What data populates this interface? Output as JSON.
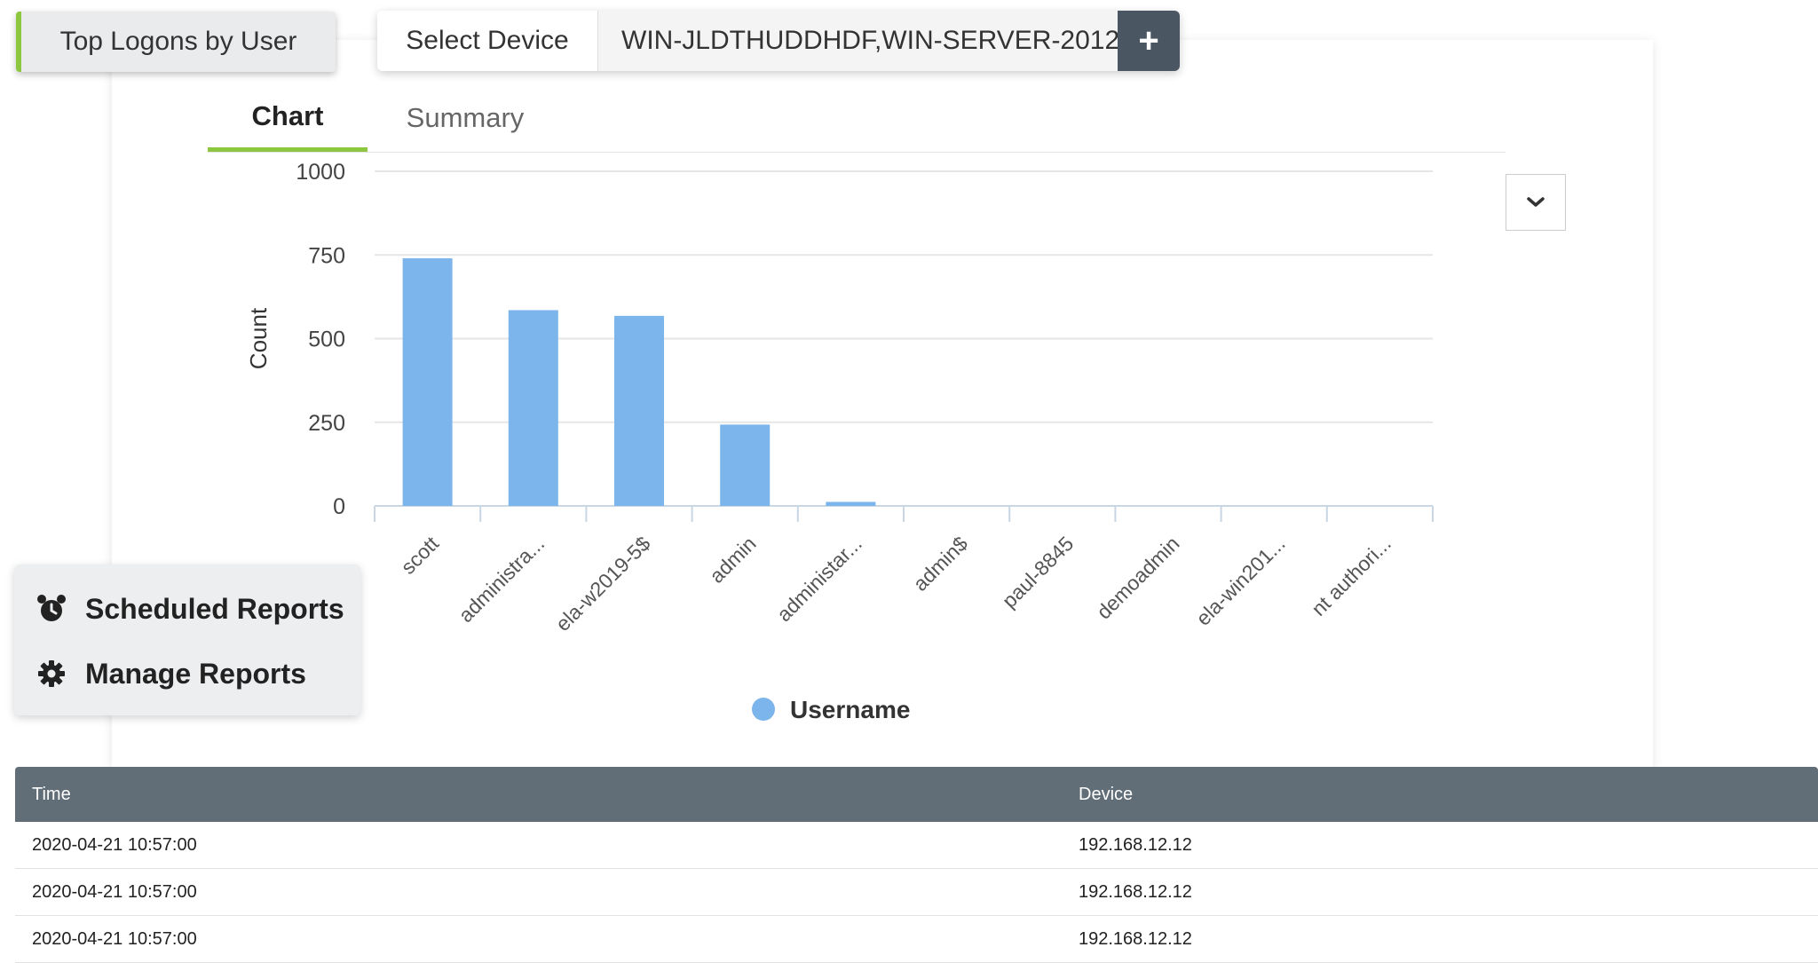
{
  "report": {
    "title": "Top Logons by User"
  },
  "device_selector": {
    "label": "Select Device",
    "value": "WIN-JLDTHUDDHDF,WIN-SERVER-2012",
    "add_icon": "plus-icon"
  },
  "tabs": [
    {
      "label": "Chart",
      "active": true
    },
    {
      "label": "Summary",
      "active": false
    }
  ],
  "options_icon": "chevron-down-icon",
  "chart_data": {
    "type": "bar",
    "ylabel": "Count",
    "ylim": [
      0,
      1000
    ],
    "yticks": [
      0,
      250,
      500,
      750,
      1000
    ],
    "categories": [
      "scott",
      "administra...",
      "ela-w2019-5$",
      "admin",
      "administar...",
      "admin$",
      "paul-8845",
      "demoadmin",
      "ela-win201...",
      "nt authori..."
    ],
    "series": [
      {
        "name": "Username",
        "color": "#7cb5ec",
        "values": [
          740,
          585,
          568,
          243,
          12,
          0,
          0,
          0,
          0,
          0
        ]
      }
    ],
    "legend": "bottom-center",
    "grid": true
  },
  "side_panel": {
    "items": [
      {
        "label": "Scheduled Reports",
        "icon": "alarm-clock-icon"
      },
      {
        "label": "Manage Reports",
        "icon": "gear-icon"
      }
    ]
  },
  "grid": {
    "headers": {
      "time": "Time",
      "device": "Device"
    },
    "rows": [
      {
        "time": "2020-04-21 10:57:00",
        "device": "192.168.12.12"
      },
      {
        "time": "2020-04-21 10:57:00",
        "device": "192.168.12.12"
      },
      {
        "time": "2020-04-21 10:57:00",
        "device": "192.168.12.12"
      }
    ]
  }
}
